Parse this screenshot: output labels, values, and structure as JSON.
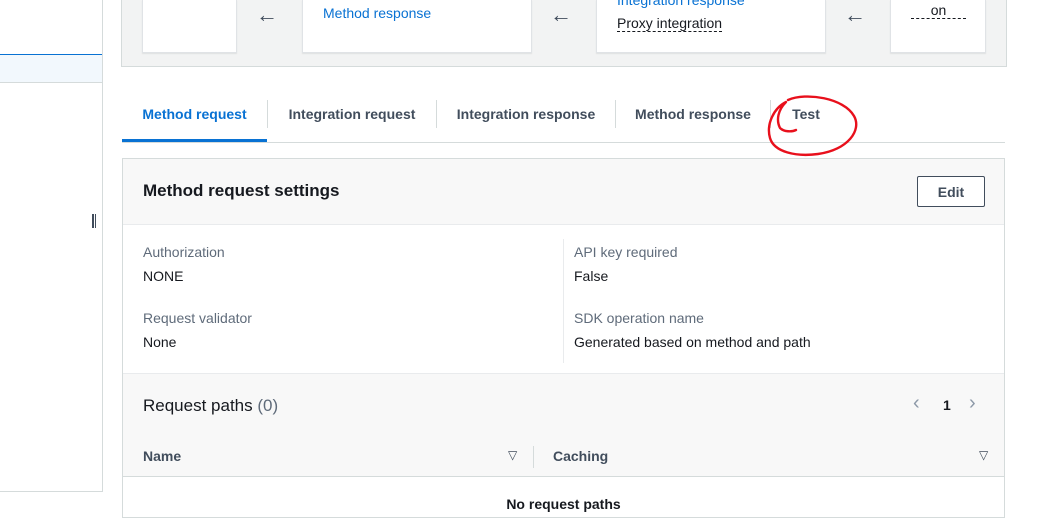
{
  "flow": {
    "method_response_label": "Method response",
    "integration_response_label": "Integration response",
    "integration_type": "Proxy integration",
    "client_label": "on",
    "arrow_glyph": "←"
  },
  "tabs": [
    {
      "label": "Method request",
      "active": true
    },
    {
      "label": "Integration request",
      "active": false
    },
    {
      "label": "Integration response",
      "active": false
    },
    {
      "label": "Method response",
      "active": false
    },
    {
      "label": "Test",
      "active": false
    }
  ],
  "settings": {
    "title": "Method request settings",
    "edit_label": "Edit",
    "authorization_label": "Authorization",
    "authorization_value": "NONE",
    "api_key_label": "API key required",
    "api_key_value": "False",
    "validator_label": "Request validator",
    "validator_value": "None",
    "sdk_label": "SDK operation name",
    "sdk_value": "Generated based on method and path"
  },
  "request_paths": {
    "title": "Request paths",
    "count": "(0)",
    "page": "1",
    "prev_glyph": "‹",
    "next_glyph": "›",
    "columns": [
      "Name",
      "Caching"
    ],
    "sort_glyph": "▽",
    "empty_text": "No request paths"
  },
  "colors": {
    "accent": "#0972d3",
    "annotation": "#e8101c"
  },
  "icons": [
    "arrow-left-icon",
    "chevron-left-icon",
    "chevron-right-icon",
    "sort-icon",
    "resize-handle-icon"
  ]
}
